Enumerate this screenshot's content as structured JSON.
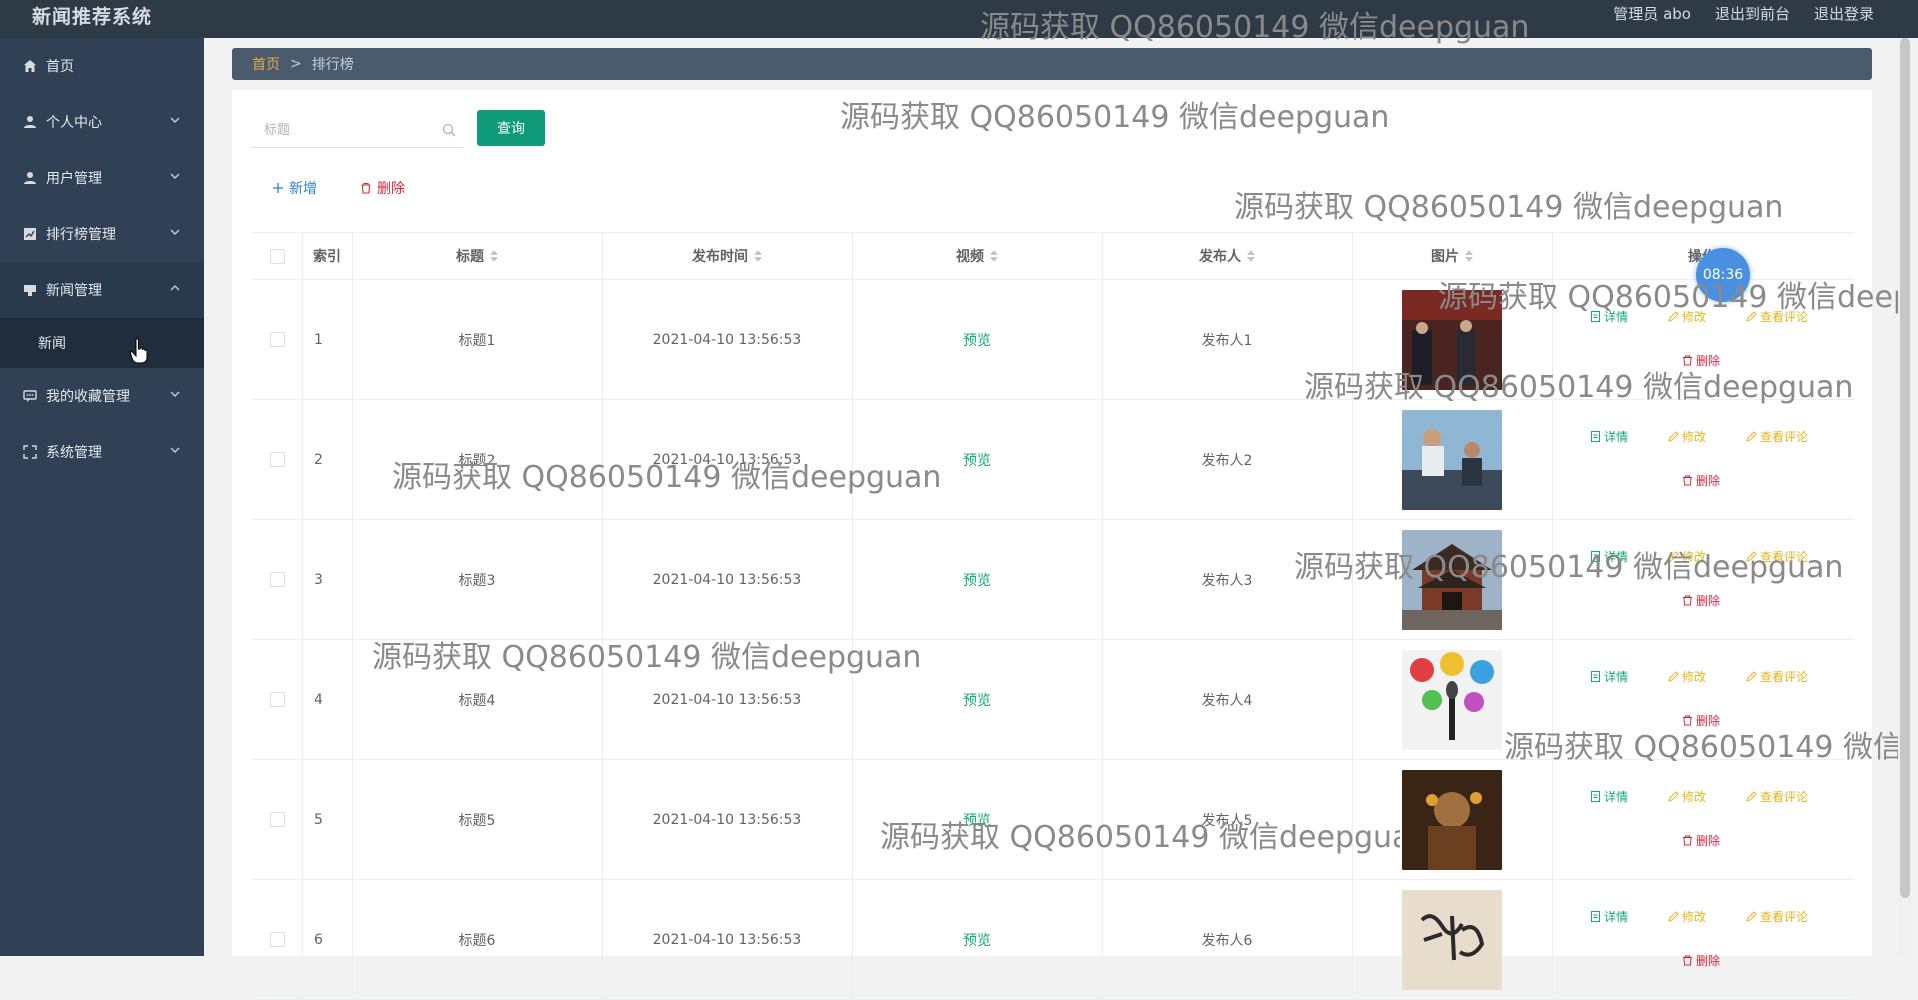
{
  "app": {
    "title": "新闻推荐系统",
    "user_label": "管理员 abo",
    "front_link": "退出到前台",
    "logout_link": "退出登录"
  },
  "sidebar": {
    "items": [
      {
        "label": "首页",
        "icon": "home-icon"
      },
      {
        "label": "个人中心",
        "icon": "user-icon"
      },
      {
        "label": "用户管理",
        "icon": "user-icon"
      },
      {
        "label": "排行榜管理",
        "icon": "chart-icon"
      },
      {
        "label": "新闻管理",
        "icon": "news-icon",
        "expanded": true
      },
      {
        "label": "新闻",
        "sub": true
      },
      {
        "label": "我的收藏管理",
        "icon": "chat-icon"
      },
      {
        "label": "系统管理",
        "icon": "fullscreen-icon"
      }
    ]
  },
  "breadcrumb": {
    "home": "首页",
    "sep": ">",
    "current": "排行榜"
  },
  "search": {
    "placeholder": "标题",
    "button": "查询"
  },
  "actions": {
    "add": "新增",
    "delete": "删除"
  },
  "table": {
    "headers": {
      "index": "索引",
      "title": "标题",
      "time": "发布时间",
      "video": "视频",
      "publisher": "发布人",
      "image": "图片",
      "ops": "操作"
    },
    "rows": [
      {
        "index": "1",
        "title": "标题1",
        "time": "2021-04-10 13:56:53",
        "video": "预览",
        "publisher": "发布人1"
      },
      {
        "index": "2",
        "title": "标题2",
        "time": "2021-04-10 13:56:53",
        "video": "预览",
        "publisher": "发布人2"
      },
      {
        "index": "3",
        "title": "标题3",
        "time": "2021-04-10 13:56:53",
        "video": "预览",
        "publisher": "发布人3"
      },
      {
        "index": "4",
        "title": "标题4",
        "time": "2021-04-10 13:56:53",
        "video": "预览",
        "publisher": "发布人4"
      },
      {
        "index": "5",
        "title": "标题5",
        "time": "2021-04-10 13:56:53",
        "video": "预览",
        "publisher": "发布人5"
      },
      {
        "index": "6",
        "title": "标题6",
        "time": "2021-04-10 13:56:53",
        "video": "预览",
        "publisher": "发布人6"
      }
    ],
    "ops": {
      "detail": "详情",
      "edit": "修改",
      "comment": "查看评论",
      "delete": "删除"
    }
  },
  "clock": "08:36",
  "watermark": "源码获取 QQ86050149 微信deepguan",
  "colors": {
    "sidebar": "#304156",
    "accent": "#0f9a7a",
    "danger": "#d6283a",
    "warning": "#e6b41a"
  }
}
